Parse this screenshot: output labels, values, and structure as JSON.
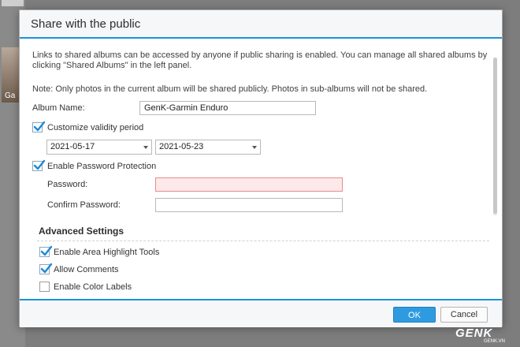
{
  "dialog": {
    "title": "Share with the public",
    "description": "Links to shared albums can be accessed by anyone if public sharing is enabled. You can manage all shared albums by clicking \"Shared Albums\" in the left panel.",
    "note": "Note: Only photos in the current album will be shared publicly. Photos in sub-albums will not be shared.",
    "album_name_label": "Album Name:",
    "album_name_value": "GenK-Garmin Enduro",
    "validity": {
      "label": "Customize validity period",
      "checked": true,
      "start_date": "2021-05-17",
      "end_date": "2021-05-23"
    },
    "password_protection": {
      "label": "Enable Password Protection",
      "checked": true,
      "password_label": "Password:",
      "confirm_label": "Confirm Password:"
    },
    "advanced": {
      "title": "Advanced Settings",
      "options": [
        {
          "label": "Enable Area Highlight Tools",
          "checked": true
        },
        {
          "label": "Allow Comments",
          "checked": true
        },
        {
          "label": "Enable Color Labels",
          "checked": false
        }
      ]
    },
    "buttons": {
      "ok": "OK",
      "cancel": "Cancel"
    }
  },
  "background": {
    "item_label": "Ga"
  },
  "watermark": {
    "brand": "GENK",
    "site": "GENK.VN"
  },
  "colors": {
    "accent": "#1a92d8",
    "ok_button": "#2e9be0",
    "error_field": "#fde9e9"
  }
}
